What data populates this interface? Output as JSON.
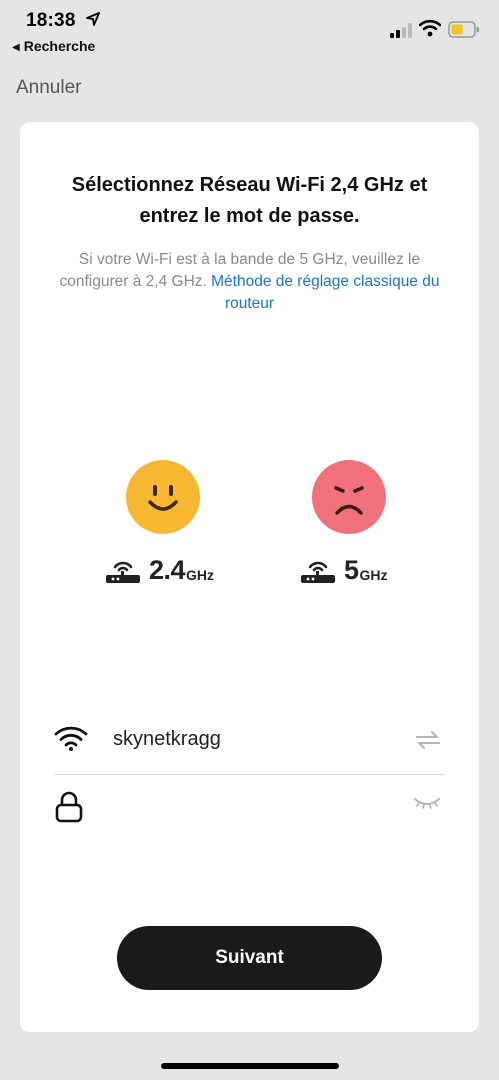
{
  "status_bar": {
    "time": "18:38",
    "back_app": "Recherche",
    "icons": [
      "location-arrow-icon",
      "cellular-signal-icon",
      "wifi-icon",
      "battery-icon"
    ],
    "battery_color": "#f5c518"
  },
  "nav": {
    "cancel_label": "Annuler"
  },
  "card": {
    "title": "Sélectionnez Réseau Wi-Fi 2,4 GHz et entrez le mot de passe.",
    "subtitle_text": "Si votre Wi-Fi est à  la bande de 5 GHz, veuillez le configurer à 2,4 GHz. ",
    "subtitle_link": "Méthode de réglage classique du routeur",
    "link_color": "#1a73d9",
    "bands": [
      {
        "face": "happy-face-icon",
        "face_color": "#f7b731",
        "value": "2.4",
        "unit": "GHz"
      },
      {
        "face": "sad-face-icon",
        "face_color": "#f0707c",
        "value": "5",
        "unit": "GHz"
      }
    ],
    "wifi_field": {
      "value": "skynetkragg",
      "icon": "wifi-icon",
      "action_icon": "switch-network-icon"
    },
    "password_field": {
      "value": "",
      "placeholder": "",
      "icon": "lock-icon",
      "action_icon": "hide-password-icon"
    },
    "next_button": "Suivant"
  }
}
